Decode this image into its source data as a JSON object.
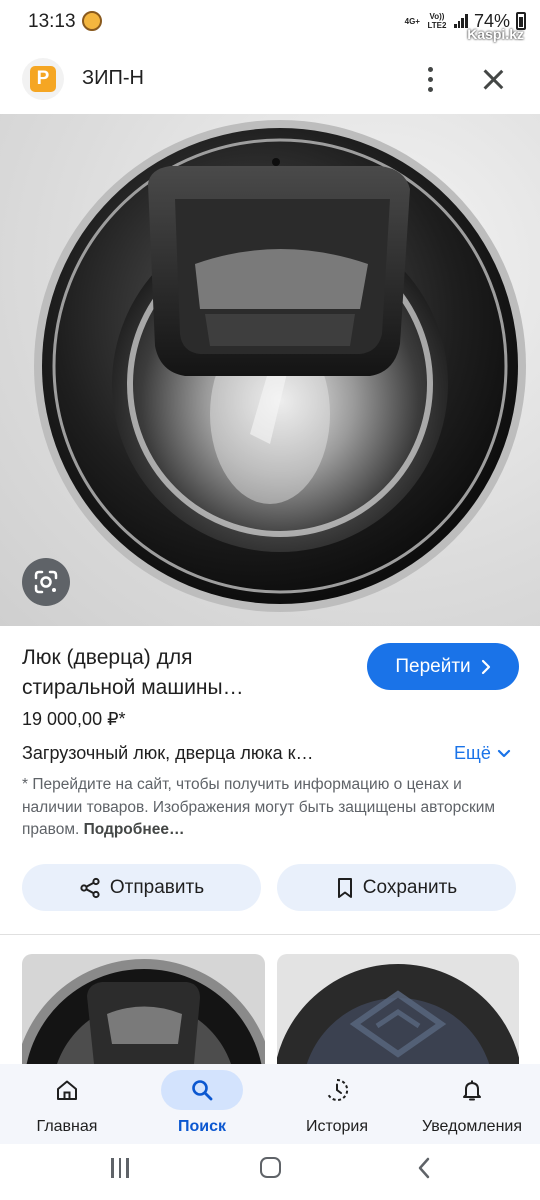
{
  "status_bar": {
    "time": "13:13",
    "network_top": "4G+",
    "network_sub": "Vo)) LTE2",
    "battery": "74%",
    "watermark": "Kaspi.kz"
  },
  "header": {
    "site_logo_letter": "P",
    "site_name": "ЗИП-Н"
  },
  "product": {
    "title_line1": "Люк (дверца) для",
    "title_line2": "стиральной машины…",
    "go_button_label": "Перейти",
    "price": "19 000,00 ₽*",
    "description": "Загрузочный люк, дверца люка к…",
    "more_label": "Ещё",
    "disclaimer_text": "* Перейдите на сайт, чтобы получить информацию о ценах и наличии товаров. Изображения могут быть защищены авторским правом.",
    "disclaimer_link": "Подробнее…"
  },
  "actions": {
    "share_label": "Отправить",
    "save_label": "Сохранить"
  },
  "bottom_nav": {
    "items": [
      {
        "label": "Главная",
        "icon": "home-icon",
        "active": false
      },
      {
        "label": "Поиск",
        "icon": "search-icon",
        "active": true
      },
      {
        "label": "История",
        "icon": "history-icon",
        "active": false
      },
      {
        "label": "Уведомления",
        "icon": "bell-icon",
        "active": false
      }
    ]
  },
  "colors": {
    "accent": "#1a73e8",
    "action_bg": "#e9f0fb",
    "nav_active_bg": "#d3e3fd",
    "logo_orange": "#f5a623"
  }
}
